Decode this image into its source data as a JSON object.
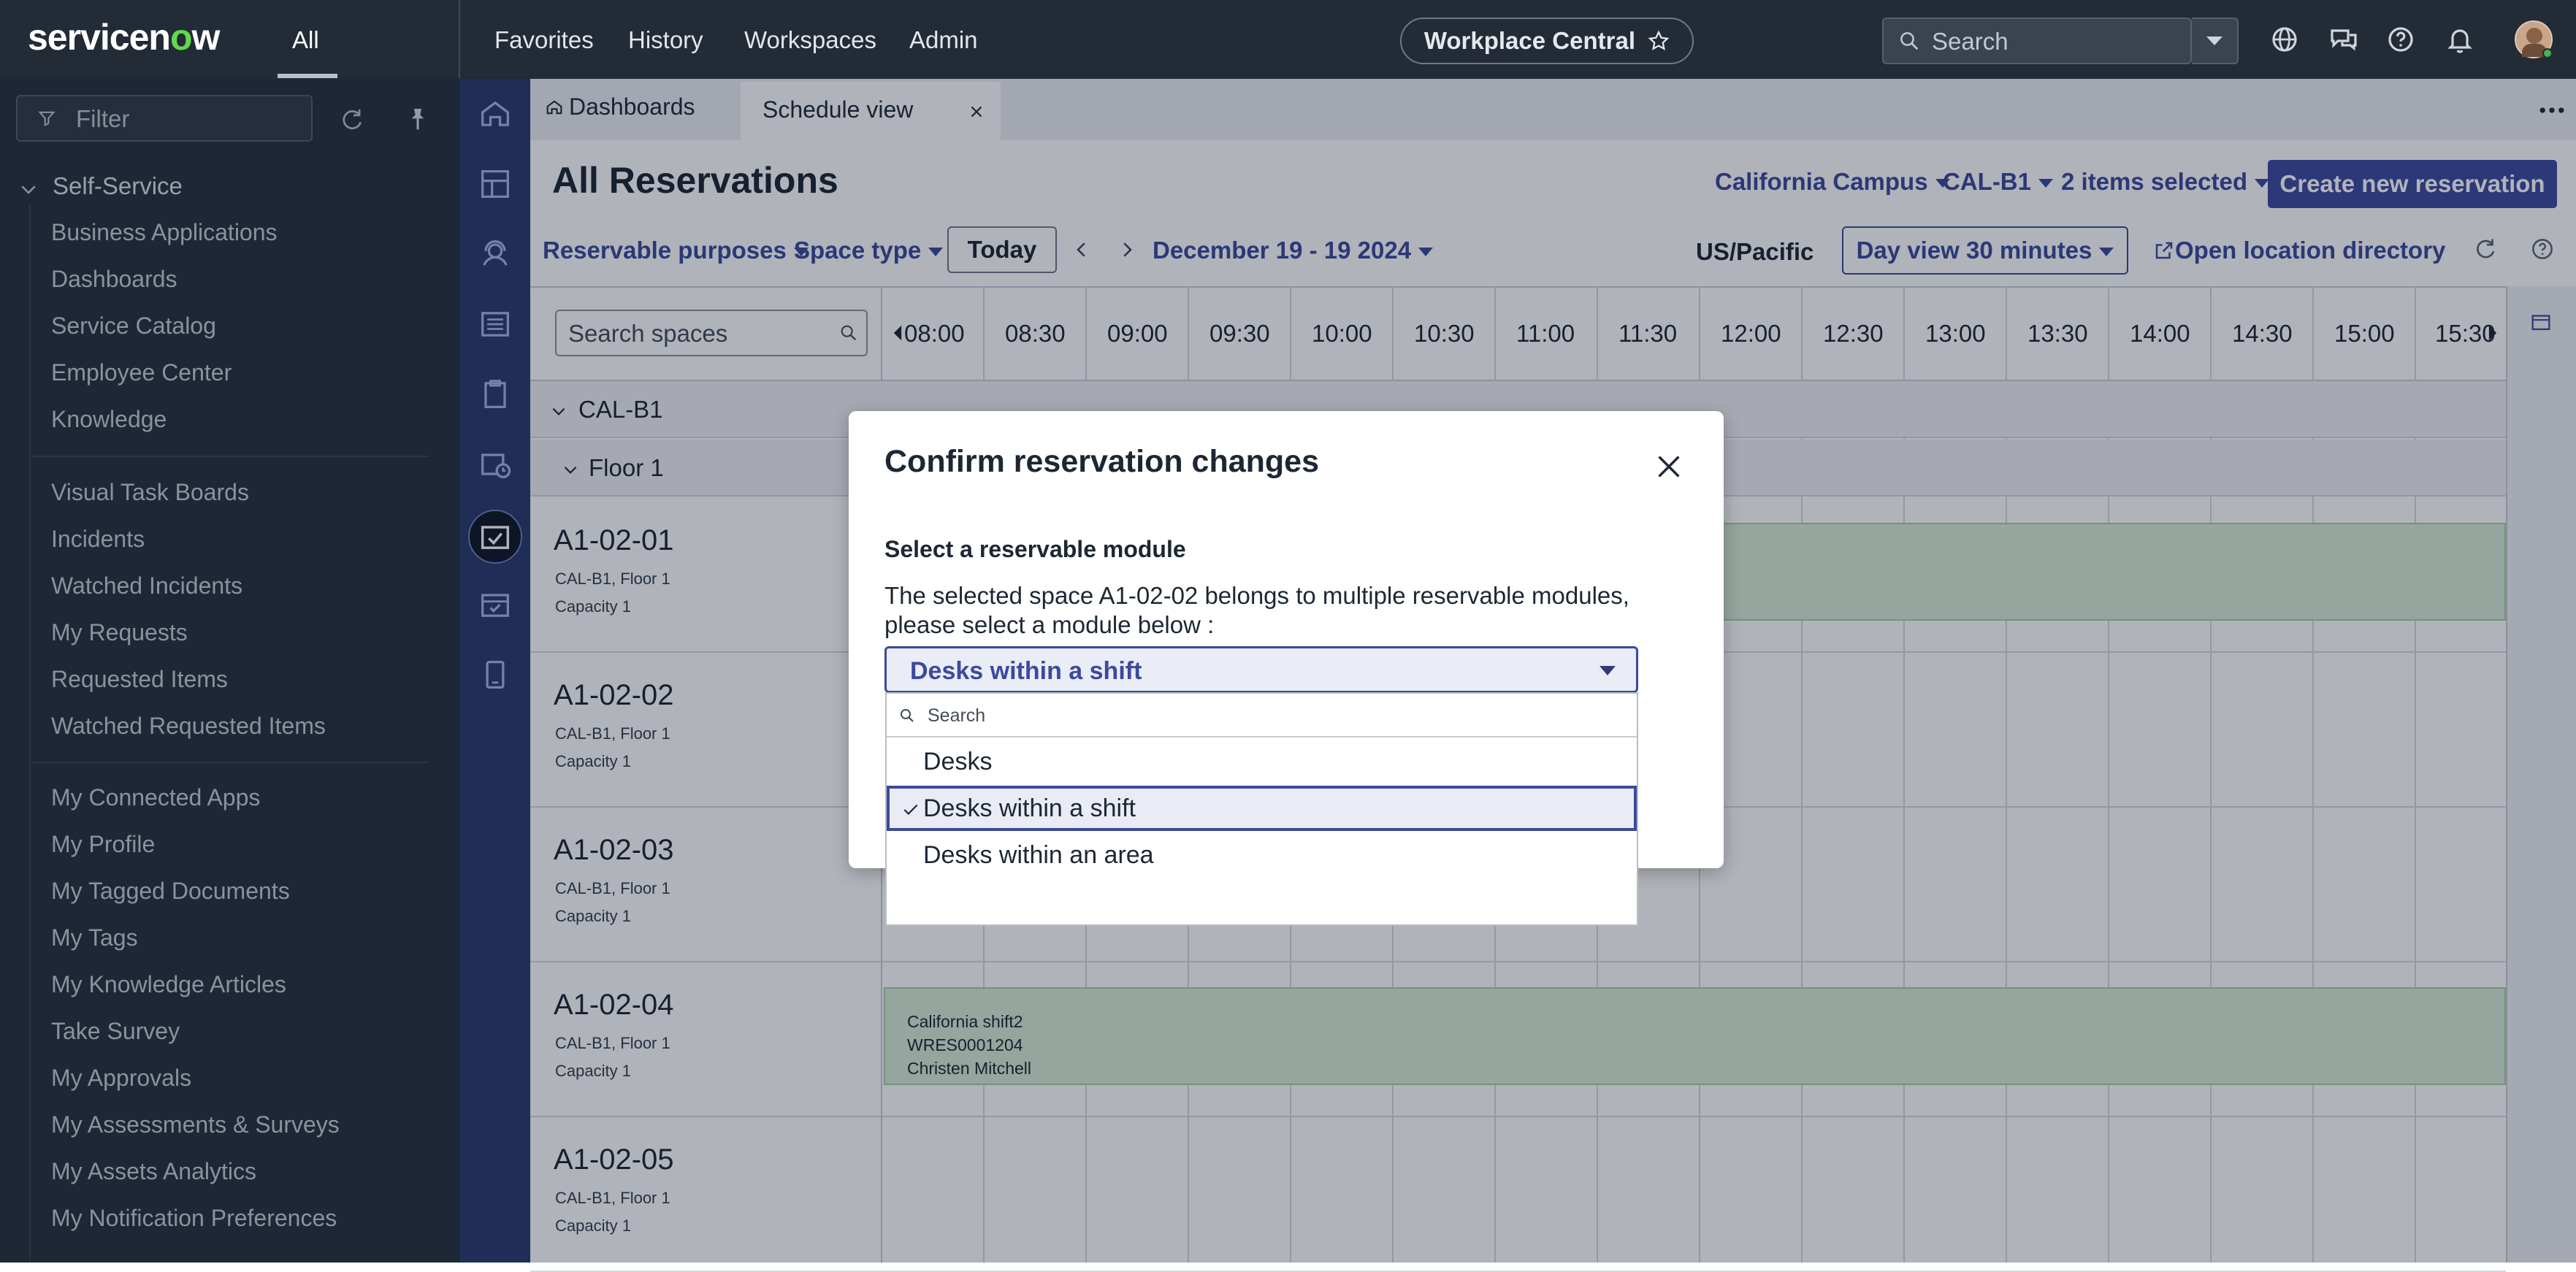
{
  "topbar": {
    "logo": "servicenow",
    "all_tab": "All",
    "nav": [
      "Favorites",
      "History",
      "Workspaces",
      "Admin"
    ],
    "workspace_pill": "Workplace Central",
    "search_placeholder": "Search"
  },
  "sidebar": {
    "filter_placeholder": "Filter",
    "section": "Self-Service",
    "group1": [
      "Business Applications",
      "Dashboards",
      "Service Catalog",
      "Employee Center",
      "Knowledge"
    ],
    "group2": [
      "Visual Task Boards",
      "Incidents",
      "Watched Incidents",
      "My Requests",
      "Requested Items",
      "Watched Requested Items"
    ],
    "group3": [
      "My Connected Apps",
      "My Profile",
      "My Tagged Documents",
      "My Tags",
      "My Knowledge Articles",
      "Take Survey",
      "My Approvals",
      "My Assessments & Surveys",
      "My Assets Analytics",
      "My Notification Preferences"
    ]
  },
  "tabs": {
    "dashboards": "Dashboards",
    "schedule": "Schedule view"
  },
  "header": {
    "title": "All Reservations",
    "campus": "California Campus",
    "building": "CAL-B1",
    "selected": "2 items selected",
    "create_button": "Create new reservation"
  },
  "toolbar": {
    "purposes": "Reservable purposes",
    "space_type": "Space type",
    "today": "Today",
    "date_range": "December 19 - 19 2024",
    "timezone": "US/Pacific",
    "view": "Day view 30 minutes",
    "directory": "Open location directory"
  },
  "schedule": {
    "search_placeholder": "Search spaces",
    "times": [
      "08:00",
      "08:30",
      "09:00",
      "09:30",
      "10:00",
      "10:30",
      "11:00",
      "11:30",
      "12:00",
      "12:30",
      "13:00",
      "13:30",
      "14:00",
      "14:30",
      "15:00",
      "15:30"
    ],
    "building": "CAL-B1",
    "floor": "Floor 1",
    "spaces": [
      {
        "name": "A1-02-01",
        "loc": "CAL-B1, Floor 1",
        "cap": "Capacity 1"
      },
      {
        "name": "A1-02-02",
        "loc": "CAL-B1, Floor 1",
        "cap": "Capacity 1"
      },
      {
        "name": "A1-02-03",
        "loc": "CAL-B1, Floor 1",
        "cap": "Capacity 1"
      },
      {
        "name": "A1-02-04",
        "loc": "CAL-B1, Floor 1",
        "cap": "Capacity 1"
      },
      {
        "name": "A1-02-05",
        "loc": "CAL-B1, Floor 1",
        "cap": "Capacity 1"
      }
    ],
    "booking": {
      "title": "California shift2",
      "number": "WRES0001204",
      "person": "Christen Mitchell"
    }
  },
  "modal": {
    "title": "Confirm reservation changes",
    "label": "Select a reservable module",
    "desc": "The selected space A1-02-02 belongs to multiple reservable modules, please select a module below :",
    "selected_value": "Desks within a shift",
    "search_placeholder": "Search",
    "options": [
      "Desks",
      "Desks within a shift",
      "Desks within an area"
    ]
  },
  "colors": {
    "topbar": "#222b36",
    "sidebar": "#29313c",
    "rail": "#2a3a6e",
    "accent": "#3e4a9f",
    "booking": "#d6ecd4"
  }
}
